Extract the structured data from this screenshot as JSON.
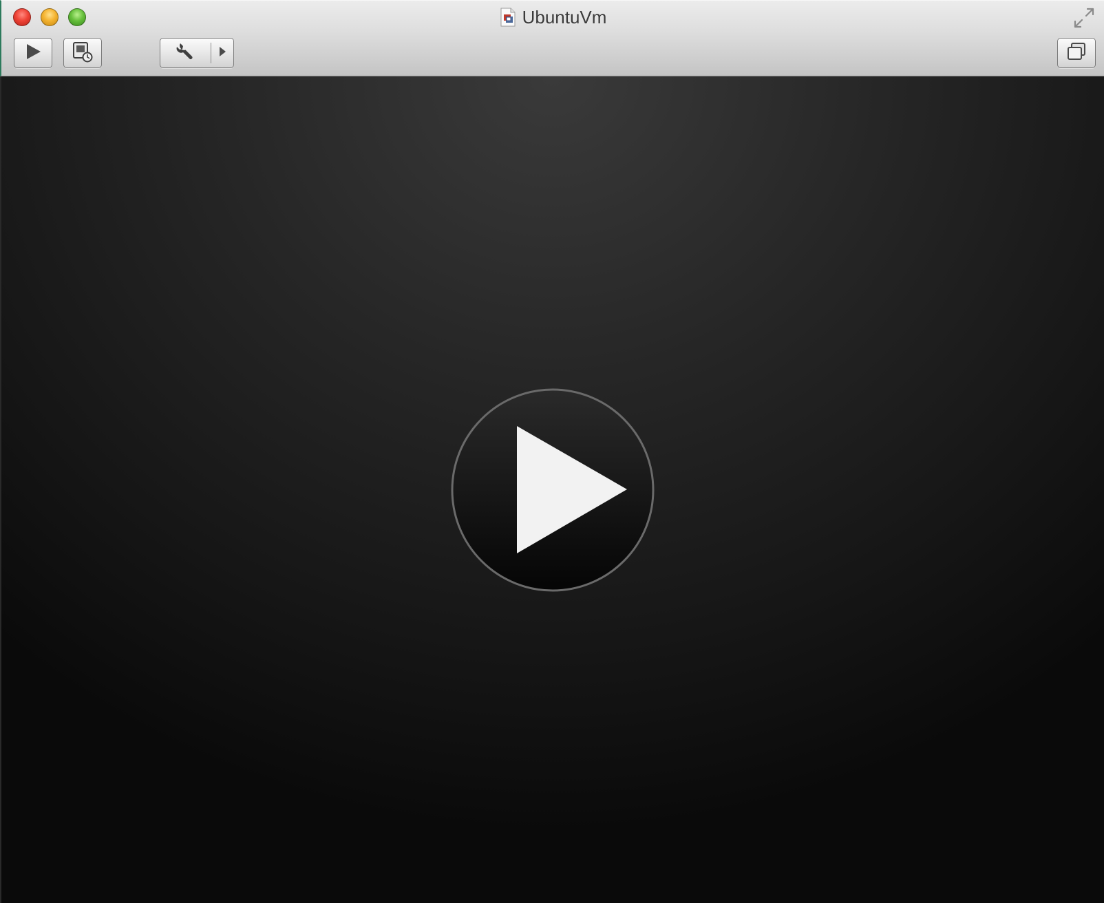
{
  "window": {
    "title": "UbuntuVm",
    "document_icon": "vm-document-icon"
  },
  "titlebar": {
    "traffic_lights": [
      "close",
      "minimize",
      "zoom"
    ],
    "fullscreen_icon": "fullscreen-arrows-icon"
  },
  "toolbar": {
    "buttons": [
      {
        "name": "start-button",
        "icon": "play-icon"
      },
      {
        "name": "snapshot-button",
        "icon": "snapshot-clock-icon"
      },
      {
        "name": "settings-button",
        "icon": "wrench-icon",
        "menu_icon": "triangle-right-icon"
      },
      {
        "name": "window-button",
        "icon": "overlapping-windows-icon"
      }
    ]
  },
  "display": {
    "play_overlay_icon": "large-play-icon"
  },
  "colors": {
    "close": "#ef4336",
    "minimize": "#f4b330",
    "zoom": "#67c03c",
    "display_background": "#1a1a1a",
    "play_triangle": "#f2f2f2"
  }
}
